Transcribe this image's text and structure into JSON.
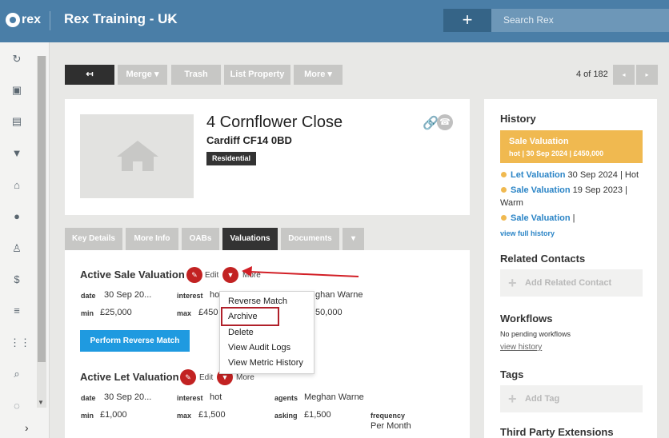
{
  "topbar": {
    "logo_text": "rex",
    "app_title": "Rex Training - UK",
    "app_chevron": "⌄",
    "plus": "+",
    "search_placeholder": "Search Rex"
  },
  "sidebar": {
    "icons": [
      "refresh-icon",
      "calendar-icon",
      "chart-icon",
      "signpost-icon",
      "home-icon",
      "person-icon",
      "contacts-icon",
      "dollar-icon",
      "list-icon",
      "grid-icon",
      "search-map-icon",
      "loading-icon"
    ],
    "expand": "›"
  },
  "toolbar": {
    "back_label": "↤",
    "buttons": [
      "Merge ▾",
      "Trash",
      "List Property",
      "More ▾"
    ],
    "pager_text": "4 of 182",
    "prev": "◂",
    "next": "▸"
  },
  "property": {
    "title": "4 Cornflower Close",
    "subtitle": "Cardiff CF14 0BD",
    "badge": "Residential"
  },
  "tabs": [
    "Key Details",
    "More Info",
    "OABs",
    "Valuations",
    "Documents",
    "▾"
  ],
  "active_tab": "Valuations",
  "sale_valuation": {
    "title": "Active Sale Valuation",
    "edit": "Edit",
    "more": "More",
    "date_label": "date",
    "date_value": "30 Sep 20...",
    "interest_label": "interest",
    "interest_value": "ho",
    "agent_value": "ghan Warne",
    "min_label": "min",
    "min_value": "£25,000",
    "max_label": "max",
    "max_value": "£450",
    "asking_value": "50,000",
    "perform_button": "Perform Reverse Match"
  },
  "menu": {
    "items": [
      "Reverse Match",
      "Archive",
      "Delete",
      "View Audit Logs",
      "View Metric History"
    ]
  },
  "let_valuation": {
    "title": "Active Let Valuation",
    "edit": "Edit",
    "more": "More",
    "date_label": "date",
    "date_value": "30 Sep 20...",
    "interest_label": "interest",
    "interest_value": "hot",
    "agents_label": "agents",
    "agents_value": "Meghan Warne",
    "min_label": "min",
    "min_value": "£1,000",
    "max_label": "max",
    "max_value": "£1,500",
    "asking_label": "asking",
    "asking_value": "£1,500",
    "frequency_label": "frequency",
    "frequency_value": "Per Month"
  },
  "history": {
    "heading": "History",
    "highlight_title": "Sale Valuation",
    "highlight_sub": "hot | 30 Sep 2024 | £450,000",
    "entries": [
      {
        "link": "Let Valuation",
        "text_line1": " 30 Sep 2024 | Hot",
        "text_line2": ""
      },
      {
        "link": "Sale Valuation",
        "text_line1": " 19 Sep 2023 |",
        "text_line2": "Warm"
      },
      {
        "link": "Sale Valuation",
        "text_line1": " |",
        "text_line2": ""
      }
    ],
    "view_full": "view full history"
  },
  "related_contacts": {
    "heading": "Related Contacts",
    "add": "Add Related Contact"
  },
  "workflows": {
    "heading": "Workflows",
    "none": "No pending workflows",
    "view": "view history"
  },
  "tags": {
    "heading": "Tags",
    "add": "Add Tag"
  },
  "third_party": {
    "heading": "Third Party Extensions"
  },
  "colors": {
    "topbar": "#4a7ea7",
    "accent_red": "#c22222",
    "highlight": "#f0b950",
    "link": "#2a84c6",
    "button_blue": "#1f9ae0"
  }
}
